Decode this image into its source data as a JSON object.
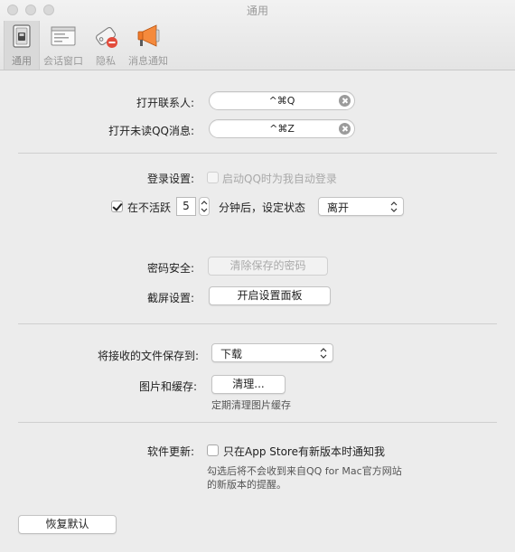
{
  "window": {
    "title": "通用"
  },
  "toolbar": {
    "items": [
      {
        "label": "通用",
        "icon": "switch-icon",
        "selected": true
      },
      {
        "label": "会话窗口",
        "icon": "chat-window-icon",
        "selected": false
      },
      {
        "label": "隐私",
        "icon": "privacy-tag-icon",
        "selected": false
      },
      {
        "label": "消息通知",
        "icon": "megaphone-icon",
        "selected": false
      }
    ]
  },
  "shortcuts": {
    "open_contacts_label": "打开联系人:",
    "open_contacts_value": "^⌘Q",
    "open_unread_label": "打开未读QQ消息:",
    "open_unread_value": "^⌘Z"
  },
  "login": {
    "label": "登录设置:",
    "auto_login_text": "启动QQ时为我自动登录",
    "inactive_text": "在不活跃",
    "inactive_minutes": "5",
    "after_text": "分钟后，设定状态",
    "status_value": "离开"
  },
  "security": {
    "password_label": "密码安全:",
    "clear_password_button": "清除保存的密码",
    "screenshot_label": "截屏设置:",
    "open_panel_button": "开启设置面板"
  },
  "files": {
    "save_to_label": "将接收的文件保存到:",
    "save_to_value": "下载",
    "cache_label": "图片和缓存:",
    "clean_button": "清理...",
    "clean_note": "定期清理图片缓存"
  },
  "update": {
    "label": "软件更新:",
    "checkbox_text": "只在App Store有新版本时通知我",
    "note_line1": "勾选后将不会收到来自QQ for Mac官方网站",
    "note_line2": "的新版本的提醒。"
  },
  "footer": {
    "restore_defaults_button": "恢复默认"
  },
  "colors": {
    "window_bg": "#ececec",
    "badge_red": "#e24b3b",
    "megaphone_orange": "#f07a2a"
  }
}
